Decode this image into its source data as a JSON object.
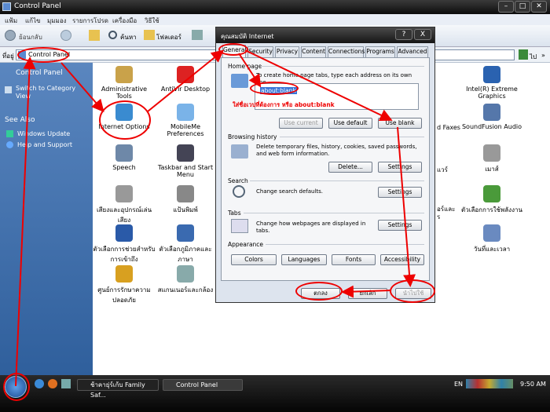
{
  "window": {
    "title": "Control Panel"
  },
  "menubar": {
    "items": [
      "แฟ้ม",
      "แก้ไข",
      "มุมมอง",
      "รายการโปรด",
      "เครื่องมือ",
      "วิธีใช้"
    ]
  },
  "toolbar": {
    "back_label": "ย้อนกลับ",
    "search_label": "ค้นหา",
    "folders_label": "โฟลเดอร์"
  },
  "address": {
    "label": "ที่อยู่",
    "value": "Control Panel",
    "go_label": "ไป",
    "links_label": "»"
  },
  "sidebar": {
    "title": "Control Panel",
    "switch_view": "Switch to Category View",
    "see_also": "See Also",
    "links": [
      "Windows Update",
      "Help and Support"
    ]
  },
  "content": {
    "items": [
      {
        "label": "Administrative Tools",
        "color": "#c9a24a"
      },
      {
        "label": "AntiVir Desktop",
        "color": "#d22"
      },
      {
        "label": "Internet Options",
        "color": "#3a8bd0"
      },
      {
        "label": "MobileMe Preferences",
        "color": "#7ab3e8"
      },
      {
        "label": "Speech",
        "color": "#6e88a8"
      },
      {
        "label": "Taskbar and Start Menu",
        "color": "#445"
      },
      {
        "label": "เสียงและอุปกรณ์เล่นเสียง",
        "color": "#999"
      },
      {
        "label": "แป้นพิมพ์",
        "color": "#888"
      },
      {
        "label": "ตัวเลือกการช่วยสำหรับการเข้าถึง",
        "color": "#2a5aa8"
      },
      {
        "label": "ตัวเลือกภูมิภาคและภาษา",
        "color": "#3a6ab0"
      },
      {
        "label": "ศูนย์การรักษาความปลอดภัย",
        "color": "#d8a020"
      },
      {
        "label": "สแกนเนอร์และกล้อง",
        "color": "#8aa"
      },
      {
        "label": "Intel(R) Extreme Graphics",
        "color": "#2a62b0"
      },
      {
        "label": "SoundFusion Audio",
        "color": "#5577aa"
      },
      {
        "label": "เมาส์",
        "color": "#999"
      },
      {
        "label": "ตัวเลือกการใช้พลังงาน",
        "color": "#4a9a3a"
      },
      {
        "label": "วันที่และเวลา",
        "color": "#6a8ac0"
      }
    ],
    "partial": [
      "d Faxes",
      "แวร์",
      "อร์และ",
      "ร"
    ]
  },
  "dialog": {
    "title": "คุณสมบัติ Internet",
    "help_btn": "?",
    "close_btn": "X",
    "tabs": [
      "General",
      "Security",
      "Privacy",
      "Content",
      "Connections",
      "Programs",
      "Advanced"
    ],
    "home": {
      "heading": "Home page",
      "desc": "To create home page tabs, type each address on its own line.",
      "value": "about:blank",
      "btn_current": "Use current",
      "btn_default": "Use default",
      "btn_blank": "Use blank"
    },
    "annotation": "ใส่ชื่อเวปที่ต้องการ หรือ about:blank",
    "history": {
      "heading": "Browsing history",
      "desc": "Delete temporary files, history, cookies, saved passwords, and web form information.",
      "btn_delete": "Delete...",
      "btn_settings": "Settings"
    },
    "search": {
      "heading": "Search",
      "desc": "Change search defaults.",
      "btn_settings": "Settings"
    },
    "tabs_section": {
      "heading": "Tabs",
      "desc": "Change how webpages are displayed in tabs.",
      "btn_settings": "Settings"
    },
    "appearance": {
      "heading": "Appearance",
      "btn_colors": "Colors",
      "btn_languages": "Languages",
      "btn_fonts": "Fonts",
      "btn_accessibility": "Accessibility"
    },
    "footer": {
      "ok": "ตกลง",
      "cancel": "ยกเลิก",
      "apply": "นำไปใช้"
    }
  },
  "taskbar": {
    "items": [
      "ช้าคายุ่ร์เก้บ Family Saf...",
      "Control Panel"
    ],
    "lang": "EN",
    "time": "9:50 AM"
  }
}
